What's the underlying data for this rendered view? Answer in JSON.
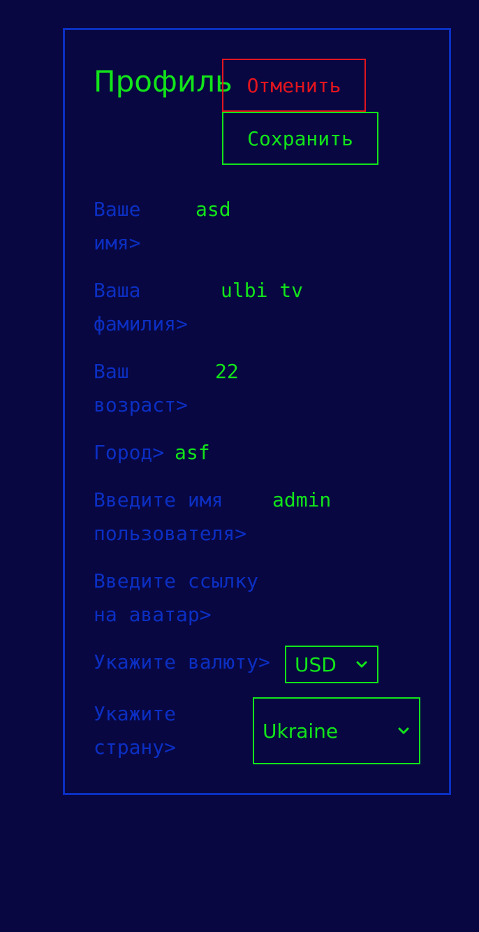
{
  "profile": {
    "title": "Профиль",
    "cancel_label": "Отменить",
    "save_label": "Сохранить"
  },
  "fields": {
    "first_name": {
      "label": "Ваше\nимя>",
      "value": "asd"
    },
    "last_name": {
      "label": "Ваша\nфамилия>",
      "value": "ulbi tv"
    },
    "age": {
      "label": "Ваш\nвозраст>",
      "value": "22"
    },
    "city": {
      "label": "Город>",
      "value": "asf"
    },
    "username": {
      "label": "Введите имя\nпользователя>",
      "value": "admin"
    },
    "avatar": {
      "label": "Введите ссылку\nна аватар>",
      "value": ""
    },
    "currency": {
      "label": "Укажите валюту>",
      "value": "USD"
    },
    "country": {
      "label": "Укажите\nстрану>",
      "value": "Ukraine"
    }
  },
  "colors": {
    "background": "#080742",
    "border": "#0c2fc3",
    "accent_green": "#12e41a",
    "accent_red": "#e3151e",
    "label_blue": "#0c2fc3"
  },
  "icons": {
    "currency_dropdown": "chevron-down-icon",
    "country_dropdown": "chevron-down-icon"
  }
}
